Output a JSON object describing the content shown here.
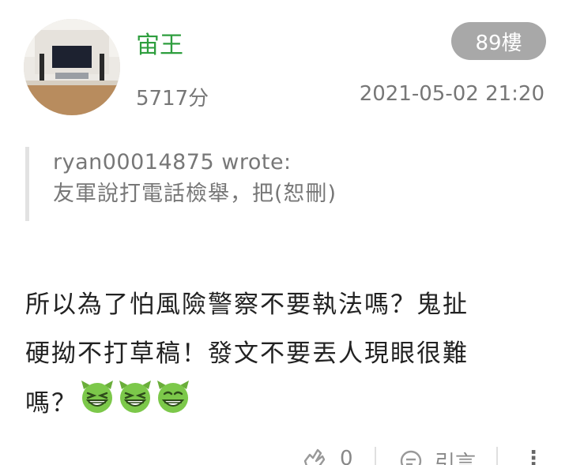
{
  "post": {
    "username": "宙王",
    "score": "5717分",
    "floor": "89樓",
    "timestamp": "2021-05-02 21:20",
    "quote": {
      "author": "ryan00014875 wrote:",
      "text": "友軍說打電話檢舉，把(恕刪)"
    },
    "body": {
      "line1": "所以為了怕風險警察不要執法嗎？鬼扯",
      "line2": "硬拗不打草稿！發文不要丟人現眼很難",
      "line3": "嗎？"
    },
    "emoji_names": [
      "grinning-devil-emoji",
      "grinning-devil-emoji",
      "grinning-devil-emoji"
    ]
  },
  "actions": {
    "like_count": "0",
    "quote_label": "引言",
    "more_label": "⋮"
  },
  "colors": {
    "username": "#2e9e3e",
    "badge_bg": "#a8a8a8",
    "meta_text": "#777777",
    "emoji_green": "#7cc84a"
  }
}
